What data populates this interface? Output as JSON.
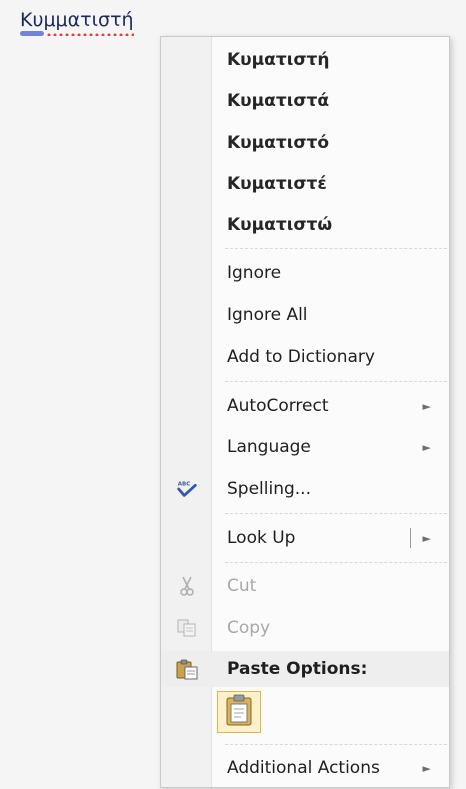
{
  "document": {
    "misspelled_word": "Κυμματιστή"
  },
  "menu": {
    "suggestions": [
      "Κυματιστή",
      "Κυματιστά",
      "Κυματιστό",
      "Κυματιστέ",
      "Κυματιστώ"
    ],
    "ignore_label": "Ignore",
    "ignore_all_label": "Ignore All",
    "add_to_dictionary_label": "Add to Dictionary",
    "autocorrect_label": "AutoCorrect",
    "language_label": "Language",
    "spelling_label": "Spelling...",
    "look_up_label": "Look Up",
    "cut_label": "Cut",
    "copy_label": "Copy",
    "paste_options_label": "Paste Options:",
    "additional_actions_label": "Additional Actions",
    "submenu_arrow": "►"
  },
  "icons": {
    "spelling": "spelling-check-icon",
    "cut": "scissors-icon",
    "copy": "copy-icon",
    "paste_options": "clipboard-icon",
    "keep_text_only": "paste-keep-text-icon"
  },
  "colors": {
    "menu_background": "#fbfbfb",
    "gutter": "#f1f1f1",
    "highlight": "#eeeeee",
    "disabled_text": "#a8a8a8",
    "spell_squiggle": "#e04040",
    "paste_button_border": "#e0b44a"
  }
}
